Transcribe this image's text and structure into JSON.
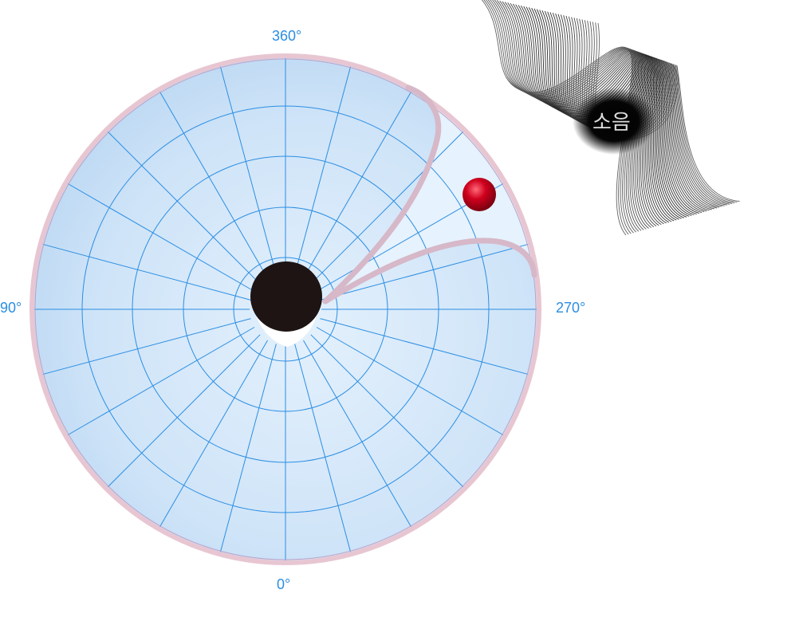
{
  "polar_dial": {
    "labels": {
      "top": "360°",
      "left": "90°",
      "right": "270°",
      "bottom": "0°"
    }
  },
  "noise_wave": {
    "label": "소음"
  },
  "colors": {
    "grid_line": "#2b8ee3",
    "disc_fill": "#cfe4f8",
    "rim": "#e7c6d2",
    "center_hole": "#1d1413",
    "red_marker": "#c0001a",
    "wave_stroke": "#333333"
  }
}
